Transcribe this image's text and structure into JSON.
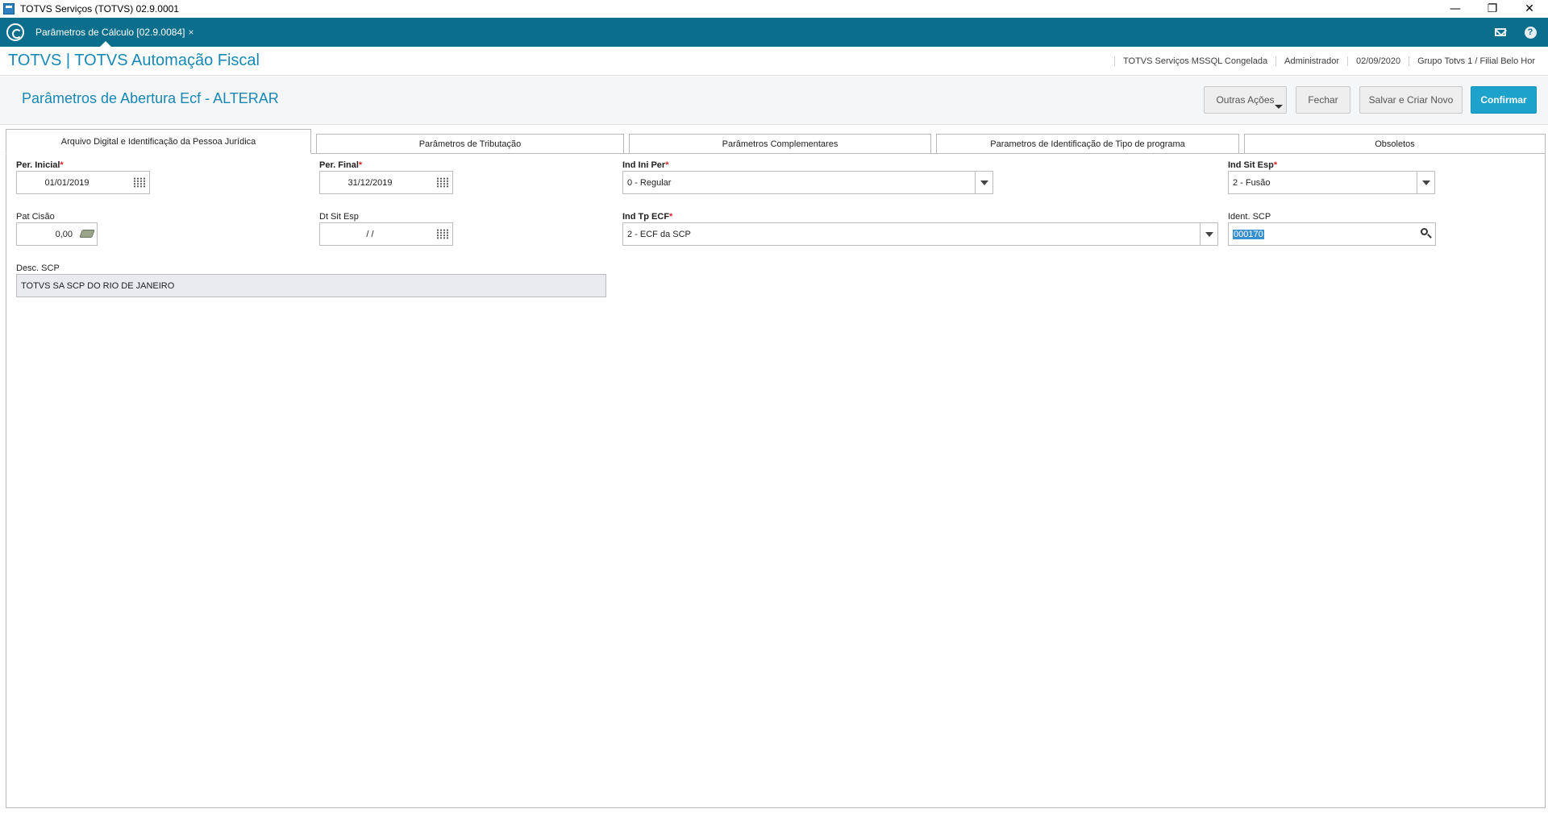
{
  "window": {
    "title": "TOTVS Serviços (TOTVS) 02.9.0001",
    "minimize": "—",
    "restore": "❐",
    "close": "✕"
  },
  "appbar": {
    "tab_label": "Parâmetros de Cálculo [02.9.0084]",
    "tab_close": "×"
  },
  "header": {
    "brand": "TOTVS | TOTVS Automação Fiscal",
    "info": [
      "TOTVS Serviços MSSQL Congelada",
      "Administrador",
      "02/09/2020",
      "Grupo Totvs 1 / Filial Belo Hor"
    ]
  },
  "page": {
    "title": "Parâmetros de Abertura Ecf - ALTERAR",
    "buttons": {
      "outras": "Outras Ações",
      "fechar": "Fechar",
      "salvar": "Salvar e Criar Novo",
      "confirmar": "Confirmar"
    }
  },
  "tabs": [
    "Arquivo Digital e Identificação da Pessoa Jurídica",
    "Parâmetros de Tributação",
    "Parâmetros Complementares",
    "Parametros de Identificação de Tipo de programa",
    "Obsoletos"
  ],
  "form": {
    "per_inicial": {
      "label": "Per. Inicial",
      "value": "01/01/2019"
    },
    "per_final": {
      "label": "Per. Final",
      "value": "31/12/2019"
    },
    "ind_ini_per": {
      "label": "Ind Ini Per",
      "value": "0 - Regular"
    },
    "ind_sit_esp": {
      "label": "Ind Sit Esp",
      "value": "2 - Fusão"
    },
    "pat_cisao": {
      "label": "Pat Cisão",
      "value": "0,00"
    },
    "dt_sit_esp": {
      "label": "Dt Sit Esp",
      "value": "/ /"
    },
    "ind_tp_ecf": {
      "label": "Ind Tp ECF",
      "value": "2 - ECF da SCP"
    },
    "ident_scp": {
      "label": "Ident. SCP",
      "value": "000170"
    },
    "desc_scp": {
      "label": "Desc. SCP",
      "value": "TOTVS SA SCP DO RIO DE JANEIRO"
    },
    "required_mark": "*"
  }
}
